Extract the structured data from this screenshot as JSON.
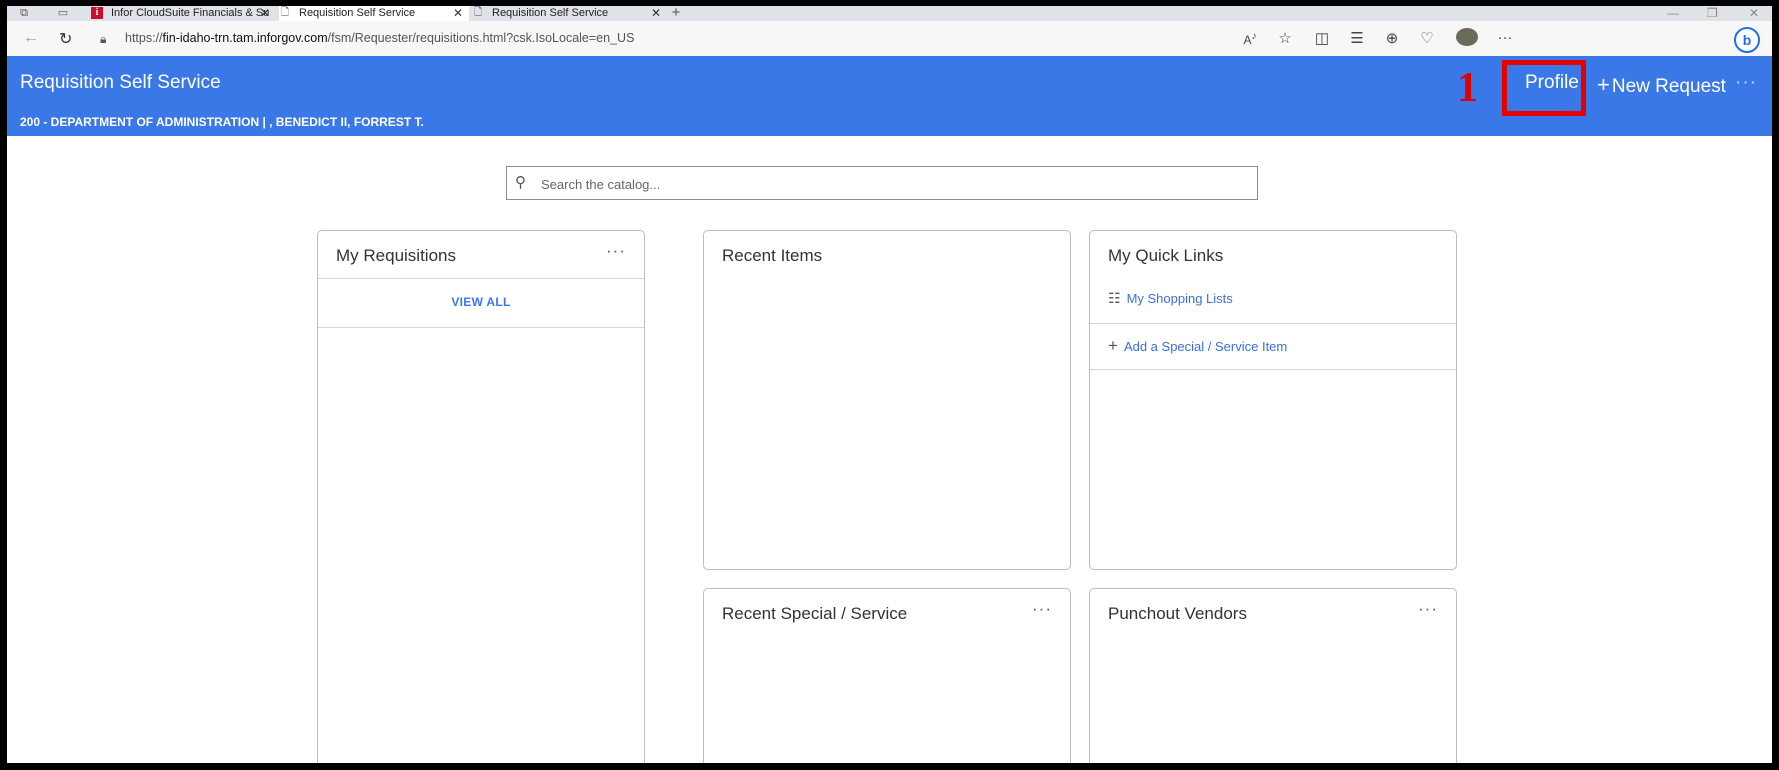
{
  "browser": {
    "tabs": [
      {
        "label": "Infor CloudSuite Financials & Su",
        "icon": "infor-logo-icon"
      },
      {
        "label": "Requisition Self Service",
        "icon": "page-icon"
      },
      {
        "label": "Requisition Self Service",
        "icon": "page-icon"
      }
    ],
    "url_prefix": "https://",
    "url_host": "fin-idaho-trn.tam.inforgov.com",
    "url_path": "/fsm/Requester/requisitions.html?csk.IsoLocale=en_US"
  },
  "header": {
    "title": "Requisition Self Service",
    "subtitle": "200 - DEPARTMENT OF ADMINISTRATION | , BENEDICT II, FORREST T.",
    "profile_label": "Profile",
    "new_request_label": "New Request",
    "more_label": "···"
  },
  "annotation": {
    "step_number": "1",
    "highlight_color": "#e60000"
  },
  "search": {
    "placeholder": "Search the catalog..."
  },
  "cards": {
    "my_requisitions": {
      "title": "My Requisitions",
      "view_all": "VIEW ALL"
    },
    "recent_items": {
      "title": "Recent Items"
    },
    "quick_links": {
      "title": "My Quick Links",
      "links": [
        "My Shopping Lists",
        "Add a Special / Service Item"
      ]
    },
    "recent_special": {
      "title": "Recent Special / Service"
    },
    "punchout": {
      "title": "Punchout Vendors"
    }
  },
  "colors": {
    "brand_blue": "#3b78e7",
    "link_blue": "#3b6fd8"
  }
}
